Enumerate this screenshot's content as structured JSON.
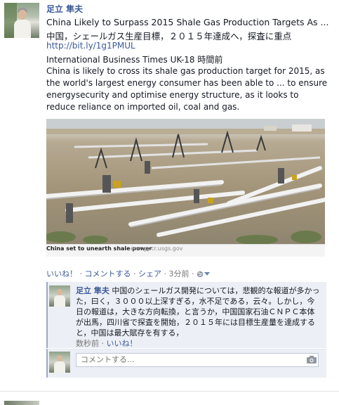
{
  "post": {
    "author": "足立 隼夫",
    "title": "China Likely to Surpass 2015 Shale Gas Production Targets As ...",
    "jp_title": "中国，シェールガス生産目標，２０１５年達成へ，探査に重点",
    "link": "http://bit.ly/1g1PMUL",
    "source": "International Business Times UK-18 時間前",
    "body": "China is likely to cross its shale gas production target for 2015, as the world's largest energy consumer has been able to ... to ensure energysecurity and optimise energy structure, as it looks to reduce reliance on imported oil, coal and gas.",
    "photo_caption": "China set to unearth shale power",
    "photo_credit": "energy.cr.usgs.gov"
  },
  "actions": {
    "like": "いいね！",
    "comment": "コメントする",
    "share": "シェア",
    "time": "3分前"
  },
  "comment": {
    "author": "足立 隼夫",
    "text": "中国のシェールガス開発については，悲観的な報道が多かった，曰く，３０００以上深すぎる，水不足である，云々。しかし，今日の報道は，大きな方向転換，と言うか，中国国家石油ＣＮＰＣ本体が出馬，四川省で探査を開始，２０１５年には目標生産量を達成すると，中国は最大賦存を有する，",
    "time": "数秒前",
    "like": "いいね！"
  },
  "reply": {
    "placeholder": "コメントする..."
  },
  "icons": {
    "audience": "globe-icon",
    "dropdown": "chevron-down-icon",
    "camera": "camera-icon"
  },
  "colors": {
    "link": "#3b5998",
    "comment_bg": "#eceff5"
  }
}
